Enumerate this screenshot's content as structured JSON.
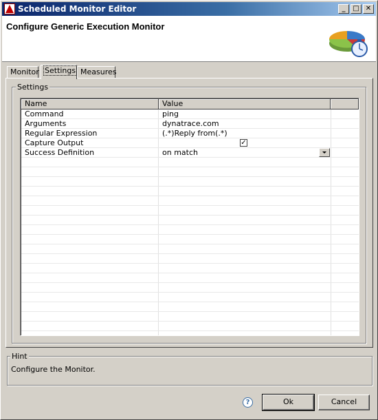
{
  "window": {
    "title": "Scheduled Monitor Editor",
    "controls": {
      "minimize": "_",
      "maximize": "□",
      "close": "✕"
    }
  },
  "banner": {
    "heading": "Configure Generic Execution Monitor",
    "logo_icon": "pie-chart-stopwatch-icon"
  },
  "tabs": [
    {
      "label": "Monitor",
      "active": false
    },
    {
      "label": "Settings",
      "active": true
    },
    {
      "label": "Measures",
      "active": false
    }
  ],
  "settings": {
    "group_label": "Settings",
    "columns": {
      "name": "Name",
      "value": "Value"
    },
    "rows": [
      {
        "name": "Command",
        "value": "ping"
      },
      {
        "name": "Arguments",
        "value": "dynatrace.com"
      },
      {
        "name": "Regular Expression",
        "value": "(.*)Reply from(.*)"
      },
      {
        "name": "Capture Output",
        "value": "",
        "checked": true
      },
      {
        "name": "Success Definition",
        "value": "on match"
      }
    ]
  },
  "hint": {
    "label": "Hint",
    "text": "Configure the Monitor."
  },
  "buttons": {
    "help": "?",
    "ok": "Ok",
    "cancel": "Cancel"
  }
}
